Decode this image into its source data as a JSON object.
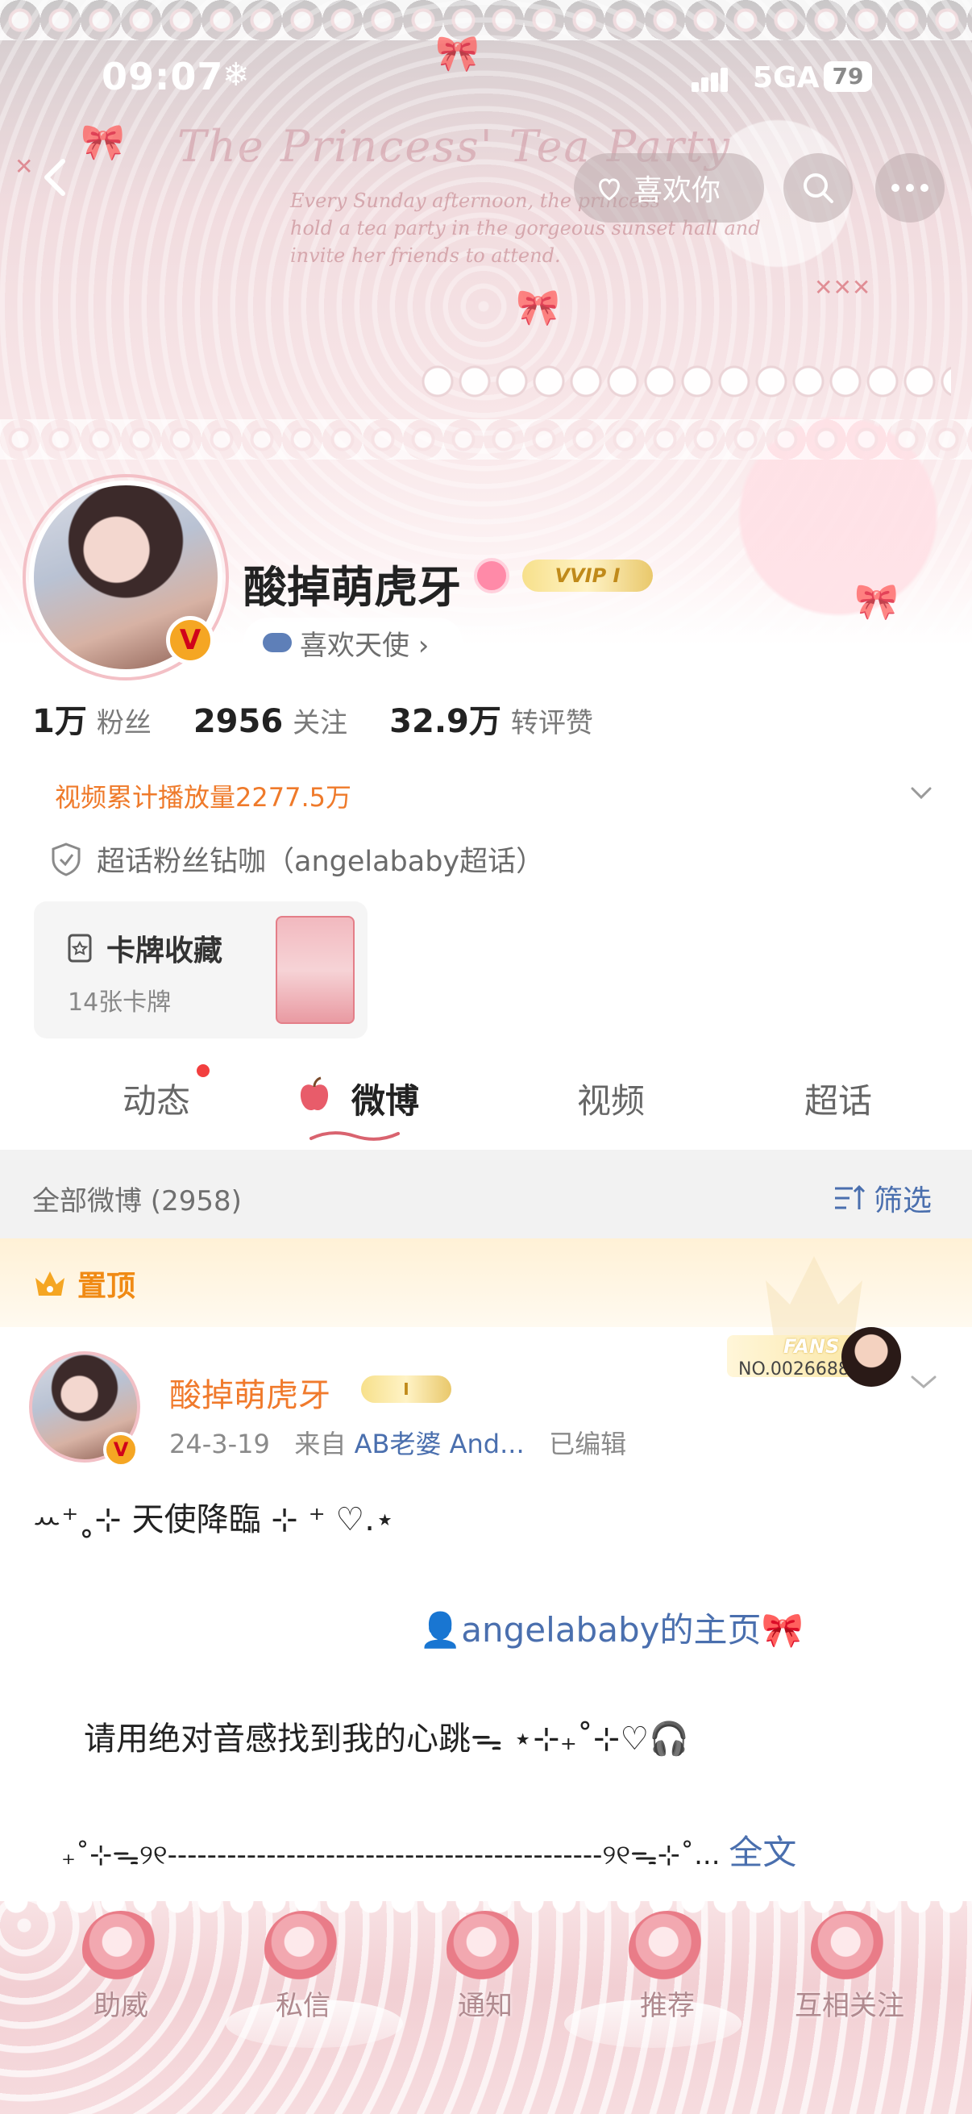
{
  "status": {
    "time": "09:07",
    "network": "5GA",
    "battery": "79"
  },
  "banner": {
    "title": "The Princess' Tea Party",
    "script_lines": [
      "Every Sunday afternoon, the princess",
      "hold a tea party in the gorgeous sunset hall and",
      "invite her friends to attend."
    ]
  },
  "nav": {
    "like_label": "喜欢你"
  },
  "profile": {
    "name": "酸掉萌虎牙",
    "vvip_label": "VVIP Ⅰ",
    "verified": "V",
    "angel_label": "喜欢天使 ›",
    "stats": [
      {
        "value": "1万",
        "label": "粉丝"
      },
      {
        "value": "2956",
        "label": "关注"
      },
      {
        "value": "32.9万",
        "label": "转评赞"
      }
    ],
    "video_plays": "视频累计播放量2277.5万",
    "supertopic": "超话粉丝钻咖（angelababy超话）",
    "card": {
      "title": "卡牌收藏",
      "subtitle": "14张卡牌"
    }
  },
  "tabs": [
    {
      "label": "动态",
      "active": false,
      "dot": true
    },
    {
      "label": "微博",
      "active": true,
      "dot": false
    },
    {
      "label": "视频",
      "active": false,
      "dot": false
    },
    {
      "label": "超话",
      "active": false,
      "dot": false
    }
  ],
  "filter": {
    "label": "全部微博 (2958)",
    "button": "筛选"
  },
  "pinned": {
    "label": "置顶",
    "fans_word": "FANS",
    "fans_no": "NO.0026688",
    "author": "酸掉萌虎牙",
    "vip_level": "Ⅰ",
    "date": "24-3-19",
    "source_prefix": "来自",
    "source": "AB老婆 And...",
    "edited": "已编辑",
    "lines": [
      "ꕀ⁺˳⊹ 天使降臨 ⊹ ⁺ ♡.⋆",
      "👤angelababy的主页🎀",
      "请用绝对音感找到我的心跳ᯓ ⋆⊹₊˚⊹♡🎧",
      "₊˚⊹ᯓ୨୧--------------------------------------------୨୧ᯓ⊹˚..."
    ],
    "more_label": "全文"
  },
  "bottom_nav": [
    "助威",
    "私信",
    "通知",
    "推荐",
    "互相关注"
  ],
  "colors": {
    "accent_orange": "#f07a2c",
    "link_blue": "#4a6fae",
    "tab_dot": "#f23f3f"
  }
}
